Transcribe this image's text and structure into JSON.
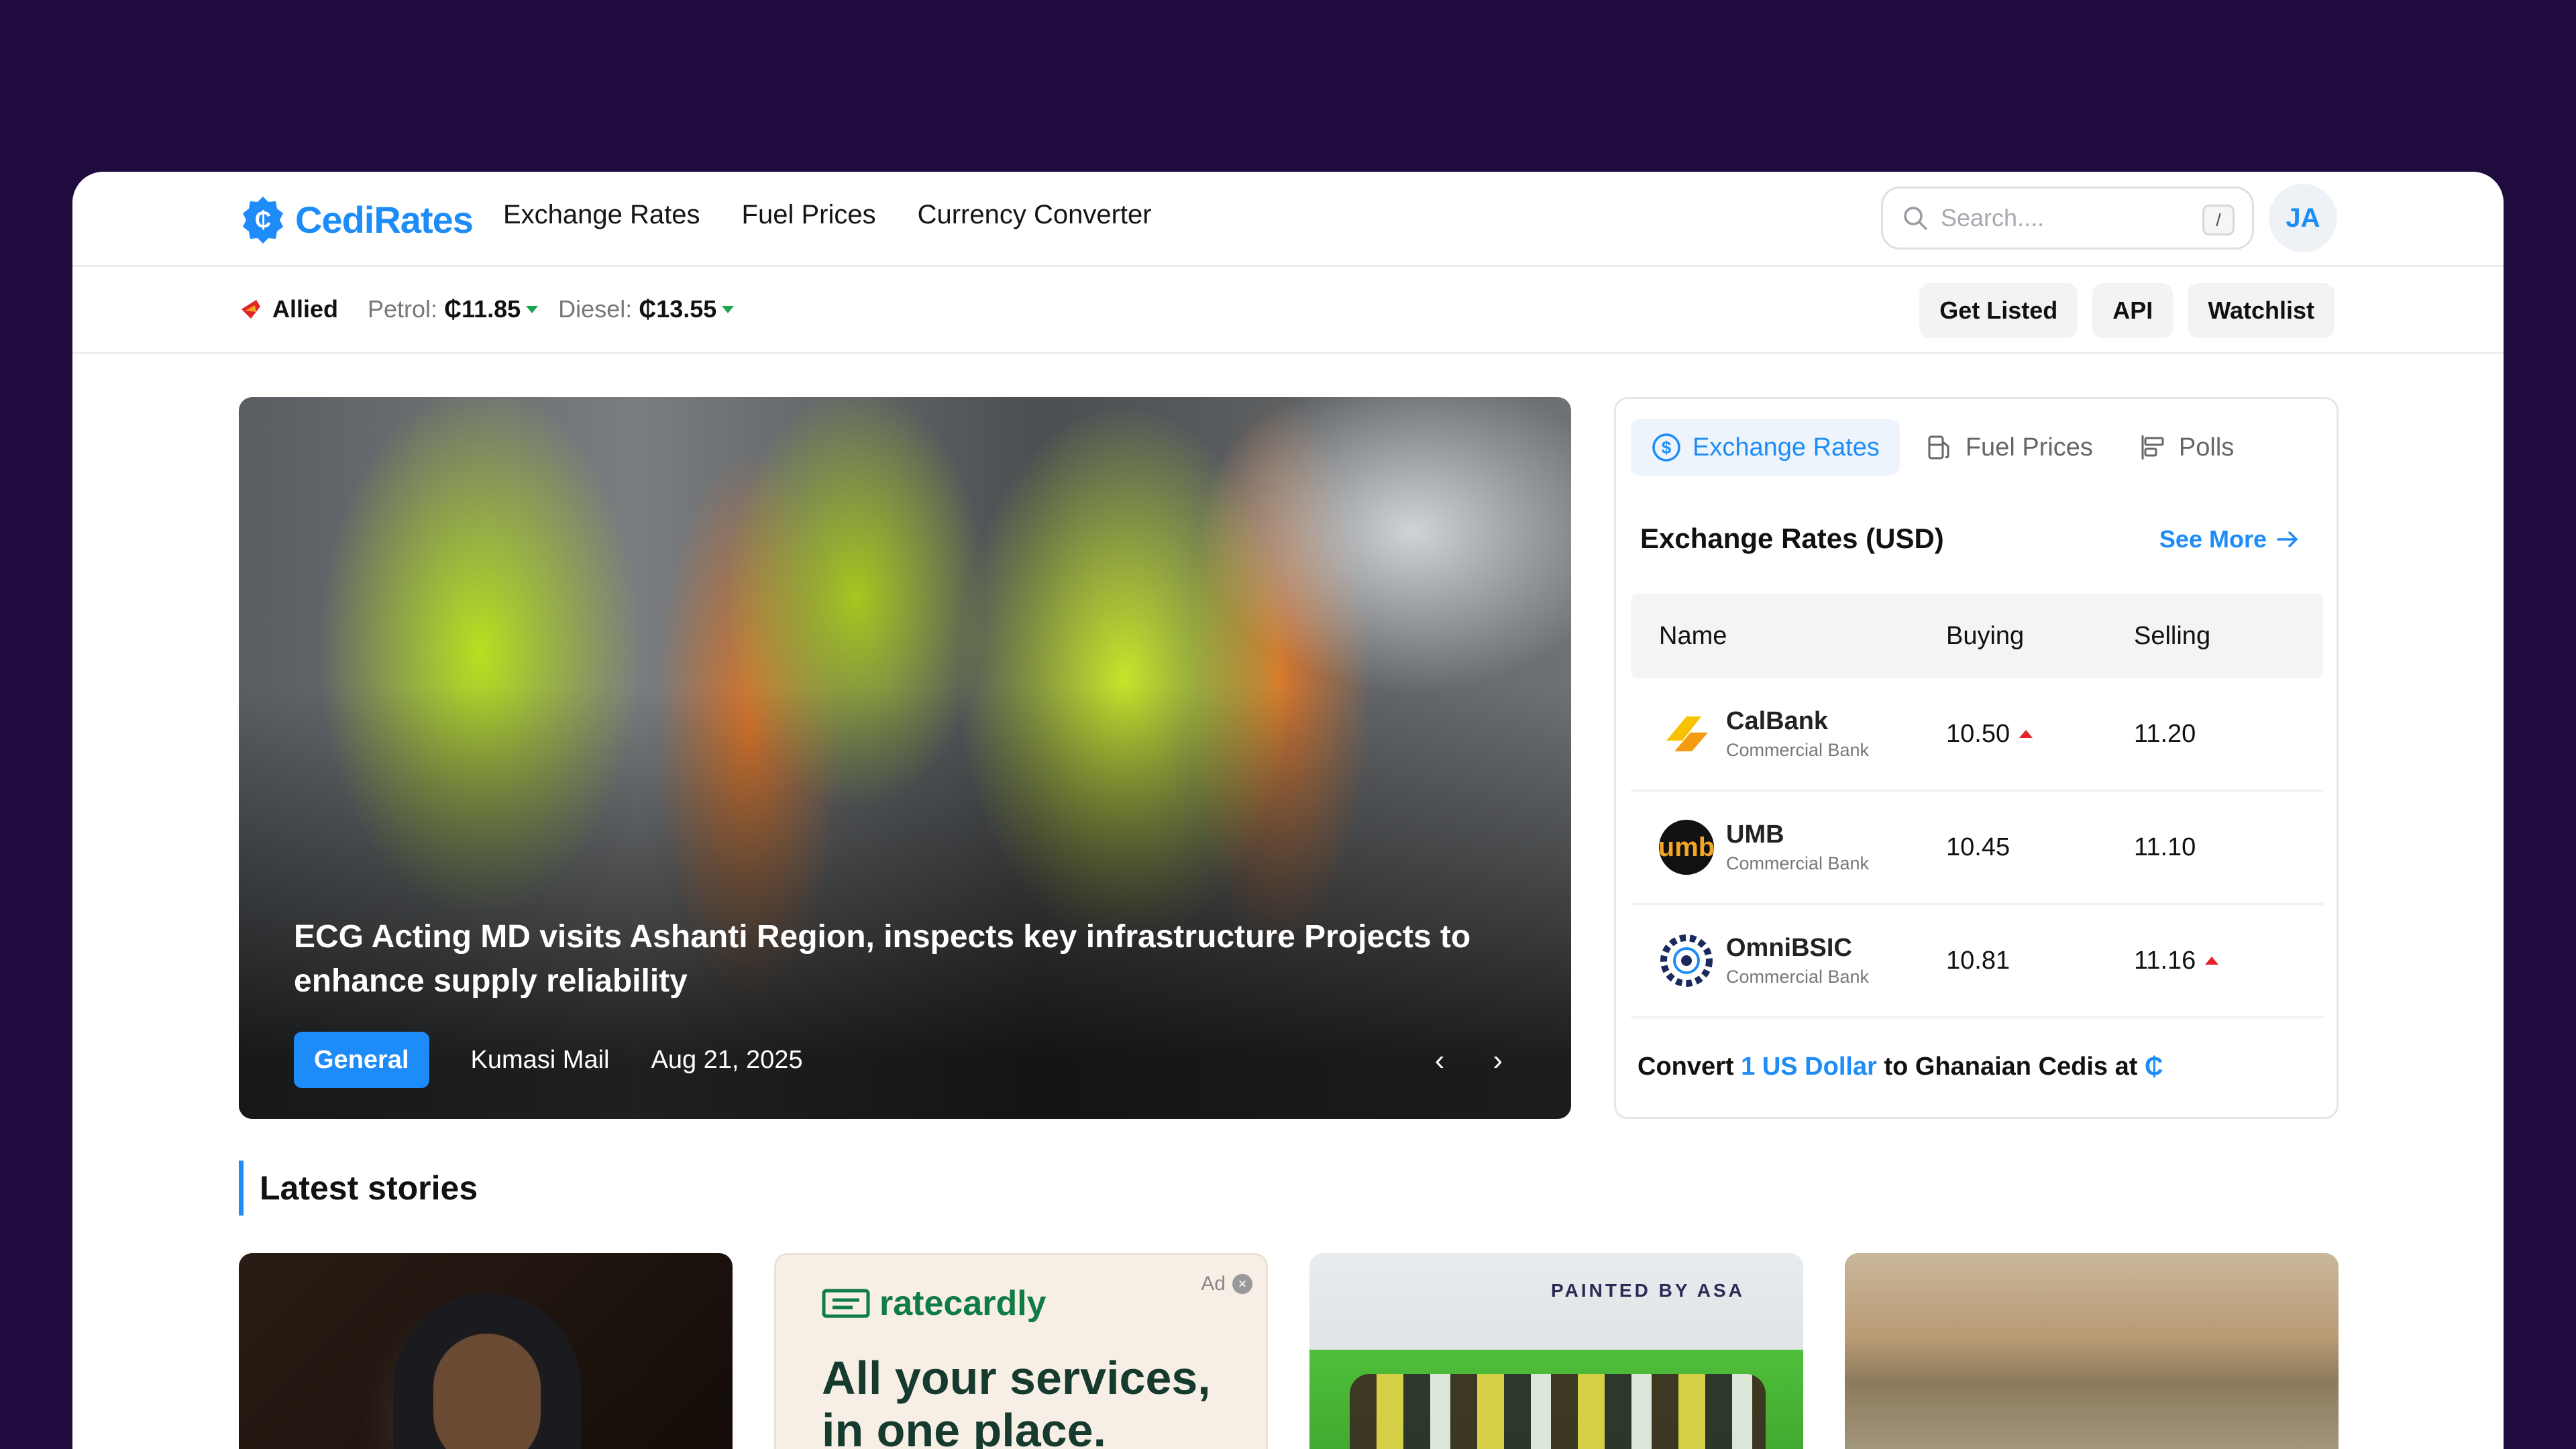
{
  "header": {
    "logo_text": "CediRates",
    "nav": [
      "Exchange Rates",
      "Fuel Prices",
      "Currency Converter"
    ],
    "search_placeholder": "Search....",
    "search_shortcut": "/",
    "avatar_initials": "JA"
  },
  "ticker": {
    "brand": "Allied",
    "petrol_label": "Petrol:",
    "petrol_value": "₵11.85",
    "diesel_label": "Diesel:",
    "diesel_value": "₵13.55"
  },
  "sub_buttons": [
    "Get Listed",
    "API",
    "Watchlist"
  ],
  "hero": {
    "title": "ECG Acting MD visits Ashanti Region, inspects key infrastructure Projects to enhance supply reliability",
    "tag": "General",
    "source": "Kumasi Mail",
    "date": "Aug 21, 2025",
    "prev": "‹",
    "next": "›"
  },
  "panel": {
    "tabs": [
      "Exchange Rates",
      "Fuel Prices",
      "Polls"
    ],
    "heading": "Exchange Rates (USD)",
    "see_more": "See More",
    "columns": [
      "Name",
      "Buying",
      "Selling"
    ],
    "rows": [
      {
        "name": "CalBank",
        "type": "Commercial Bank",
        "buying": "10.50",
        "selling": "11.20"
      },
      {
        "name": "UMB",
        "type": "Commercial Bank",
        "buying": "10.45",
        "selling": "11.10"
      },
      {
        "name": "OmniBSIC",
        "type": "Commercial Bank",
        "buying": "10.81",
        "selling": "11.16"
      }
    ],
    "convert_prefix": "Convert",
    "convert_amount": "1 US Dollar",
    "convert_suffix": "to Ghanaian Cedis at",
    "convert_symbol": "₵"
  },
  "latest": {
    "heading": "Latest stories",
    "ad_label": "Ad",
    "ad_brand": "ratecardly",
    "ad_copy_line1": "All your services,",
    "ad_copy_line2": "in one place.",
    "card3_sign": "PAINTED BY ASA"
  },
  "colors": {
    "accent": "#1d8cf8",
    "background": "#200b3f",
    "down": "#1aa653",
    "up": "#e3242b"
  }
}
